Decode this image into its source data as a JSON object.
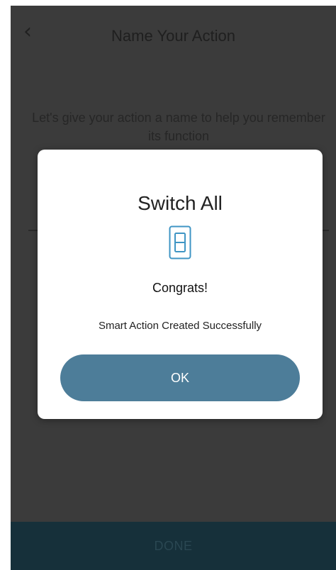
{
  "header": {
    "title": "Name Your Action",
    "back_icon": "chevron-left-icon"
  },
  "intro": {
    "text": "Let's give your action a name to help you remember its function"
  },
  "footer": {
    "done_label": "DONE"
  },
  "modal": {
    "title": "Switch All",
    "icon": "light-switch-icon",
    "congrats": "Congrats!",
    "message": "Smart Action Created Successfully",
    "ok_label": "OK"
  },
  "colors": {
    "accent": "#4d7d99",
    "overlay": "#3b3b3b",
    "done_bar": "#16303a"
  }
}
